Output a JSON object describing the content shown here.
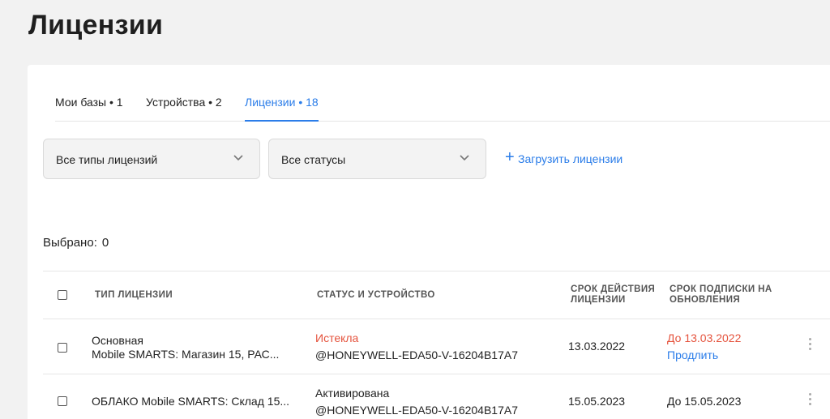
{
  "page": {
    "title": "Лицензии"
  },
  "tabs": [
    {
      "label": "Мои базы • 1"
    },
    {
      "label": "Устройства • 2"
    },
    {
      "label": "Лицензии • 18"
    }
  ],
  "filters": {
    "license_type": "Все типы лицензий",
    "status": "Все статусы",
    "upload_label": "Загрузить лицензии"
  },
  "selection": {
    "label": "Выбрано:",
    "count": "0"
  },
  "table": {
    "headers": {
      "type": "ТИП ЛИЦЕНЗИИ",
      "status": "СТАТУС И УСТРОЙСТВО",
      "validity_1": "СРОК ДЕЙСТВИЯ",
      "validity_2": "ЛИЦЕНЗИИ",
      "subscription_1": "СРОК ПОДПИСКИ НА",
      "subscription_2": "ОБНОВЛЕНИЯ"
    },
    "rows": [
      {
        "type_line1": "Основная",
        "type_line2": "Mobile SMARTS: Магазин 15, РАС...",
        "status": "Истекла",
        "device": "@HONEYWELL-EDA50-V-16204B17A7",
        "validity": "13.03.2022",
        "subscription": "До 13.03.2022",
        "action": "Продлить"
      },
      {
        "type_line1": "ОБЛАКО Mobile SMARTS: Склад 15...",
        "status": "Активирована",
        "device": "@HONEYWELL-EDA50-V-16204B17A7",
        "validity": "15.05.2023",
        "subscription": "До 15.05.2023"
      }
    ]
  },
  "colors": {
    "accent": "#2b7de9",
    "expired": "#e5533d",
    "background": "#f2f2f2"
  },
  "icons": [
    "chevron-down-icon",
    "plus-icon",
    "checkbox-icon",
    "kebab-menu-icon"
  ]
}
